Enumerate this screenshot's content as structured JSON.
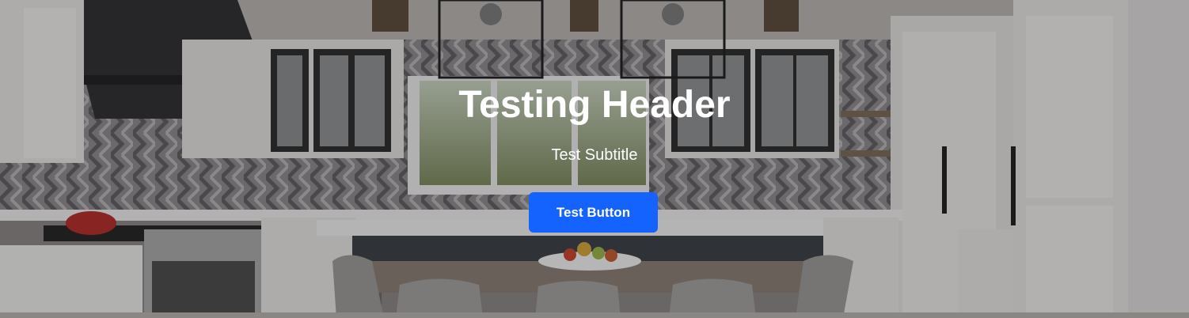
{
  "hero": {
    "title": "Testing Header",
    "subtitle": "Test Subtitle",
    "button_label": "Test Button",
    "background_image": "kitchen-interior",
    "button_color": "#1463ff",
    "text_color": "#ffffff"
  }
}
